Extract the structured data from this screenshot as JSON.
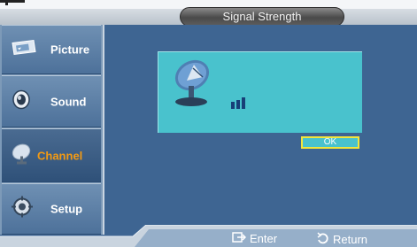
{
  "header": {
    "title": "Signal Strength"
  },
  "sidebar": {
    "items": [
      {
        "label": "Picture",
        "icon": "picture-icon",
        "active": false
      },
      {
        "label": "Sound",
        "icon": "sound-icon",
        "active": false
      },
      {
        "label": "Channel",
        "icon": "channel-icon",
        "active": true
      },
      {
        "label": "Setup",
        "icon": "setup-icon",
        "active": false
      }
    ]
  },
  "main": {
    "signal_level": 0.35,
    "ok_label": "OK"
  },
  "footer": {
    "enter_label": "Enter",
    "return_label": "Return"
  },
  "colors": {
    "background": "#3e6592",
    "panel": "#49c2cd",
    "active_label": "#f39a12",
    "focus": "#f3e63a"
  }
}
